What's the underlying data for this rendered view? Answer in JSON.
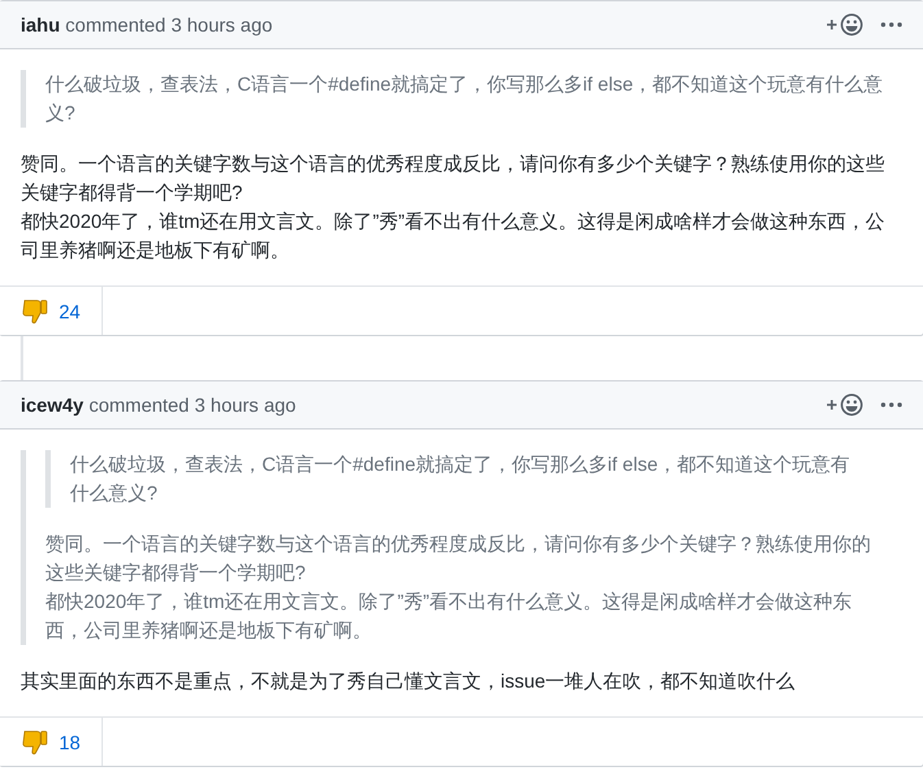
{
  "comments": [
    {
      "author": "iahu",
      "action": "commented 3 hours ago",
      "body": [
        {
          "kind": "quote",
          "children": [
            {
              "kind": "paragraph",
              "lines": [
                "什么破垃圾，查表法，C语言一个#define就搞定了，你写那么多if else，都不知道这个玩意有什么意义?"
              ]
            }
          ]
        },
        {
          "kind": "paragraph",
          "lines": [
            "赞同。一个语言的关键字数与这个语言的优秀程度成反比，请问你有多少个关键字？熟练使用你的这些关键字都得背一个学期吧?",
            "都快2020年了，谁tm还在用文言文。除了”秀”看不出有什么意义。这得是闲成啥样才会做这种东西，公司里养猪啊还是地板下有矿啊。"
          ]
        }
      ],
      "reactions": [
        {
          "count": "24"
        }
      ]
    },
    {
      "author": "icew4y",
      "action": "commented 3 hours ago",
      "body": [
        {
          "kind": "quote",
          "children": [
            {
              "kind": "quote",
              "children": [
                {
                  "kind": "paragraph",
                  "lines": [
                    "什么破垃圾，查表法，C语言一个#define就搞定了，你写那么多if else，都不知道这个玩意有什么意义?"
                  ]
                }
              ]
            },
            {
              "kind": "paragraph",
              "lines": [
                "赞同。一个语言的关键字数与这个语言的优秀程度成反比，请问你有多少个关键字？熟练使用你的这些关键字都得背一个学期吧?",
                "都快2020年了，谁tm还在用文言文。除了”秀”看不出有什么意义。这得是闲成啥样才会做这种东西，公司里养猪啊还是地板下有矿啊。"
              ]
            }
          ]
        },
        {
          "kind": "paragraph",
          "lines": [
            "其实里面的东西不是重点，不就是为了秀自己懂文言文，issue一堆人在吹，都不知道吹什么"
          ]
        }
      ],
      "reactions": [
        {
          "count": "18"
        }
      ]
    }
  ]
}
